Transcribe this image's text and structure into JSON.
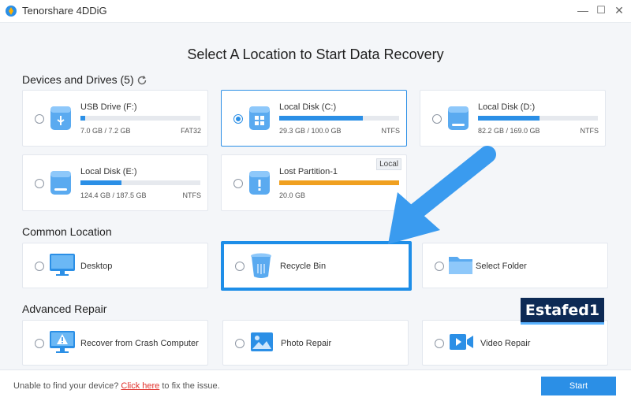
{
  "app": {
    "title": "Tenorshare 4DDiG",
    "min_glyph": "—",
    "max_glyph": "☐",
    "close_glyph": "✕"
  },
  "page_title": "Select A Location to Start Data Recovery",
  "sections": {
    "devices": "Devices and Drives (5)",
    "common": "Common Location",
    "advanced": "Advanced Repair"
  },
  "drives": [
    {
      "name": "USB Drive (F:)",
      "size": "7.0 GB / 7.2 GB",
      "fs": "FAT32",
      "fill": 0.04,
      "type": "usb",
      "selected": false
    },
    {
      "name": "Local Disk (C:)",
      "size": "29.3 GB / 100.0 GB",
      "fs": "NTFS",
      "fill": 0.7,
      "type": "windows",
      "selected": true
    },
    {
      "name": "Local Disk (D:)",
      "size": "82.2 GB / 169.0 GB",
      "fs": "NTFS",
      "fill": 0.51,
      "type": "disk",
      "selected": false
    },
    {
      "name": "Local Disk (E:)",
      "size": "124.4 GB / 187.5 GB",
      "fs": "NTFS",
      "fill": 0.34,
      "type": "disk",
      "selected": false
    },
    {
      "name": "Lost Partition-1",
      "size": "20.0 GB",
      "fs": "",
      "fill": 1.0,
      "type": "lost",
      "selected": false,
      "tag": "Local"
    }
  ],
  "common_locations": [
    {
      "label": "Desktop"
    },
    {
      "label": "Recycle Bin"
    },
    {
      "label": "Select Folder"
    }
  ],
  "advanced_repair": [
    {
      "label": "Recover from Crash Computer"
    },
    {
      "label": "Photo Repair"
    },
    {
      "label": "Video Repair"
    }
  ],
  "footer": {
    "prefix": "Unable to find your device? ",
    "link": "Click here",
    "suffix": " to fix the issue.",
    "start": "Start"
  },
  "watermark": "Estafed1",
  "colors": {
    "accent": "#2b8fe6",
    "warning": "#f0a020",
    "link": "#e0302a"
  }
}
